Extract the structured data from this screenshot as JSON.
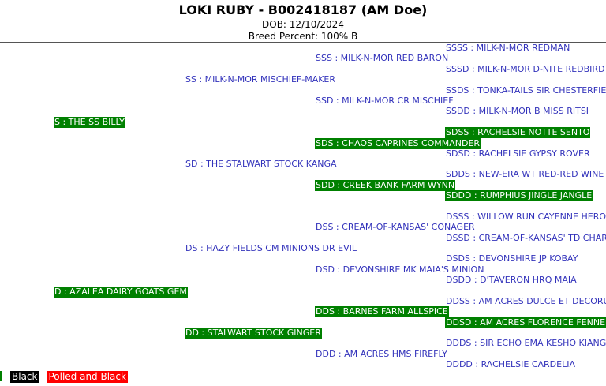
{
  "header": {
    "title": "LOKI RUBY - B002418187 (AM Doe)",
    "dob": "DOB: 12/10/2024",
    "breed_percent": "Breed Percent: 100% B"
  },
  "pedigree": {
    "S": "S : THE SS BILLY",
    "SS": "SS : MILK-N-MOR MISCHIEF-MAKER",
    "SSS": "SSS : MILK-N-MOR RED BARON",
    "SSSS": "SSSS : MILK-N-MOR REDMAN",
    "SSSD": "SSSD : MILK-N-MOR D-NITE REDBIRD",
    "SSD": "SSD : MILK-N-MOR CR MISCHIEF",
    "SSDS": "SSDS : TONKA-TAILS SIR CHESTERFIELD",
    "SSDD": "SSDD : MILK-N-MOR B MISS RITSI",
    "SD": "SD : THE STALWART STOCK KANGA",
    "SDS": "SDS : CHAOS CAPRINES COMMANDER",
    "SDSS": "SDSS : RACHELSIE NOTTE SENTO",
    "SDSD": "SDSD : RACHELSIE GYPSY ROVER",
    "SDD": "SDD : CREEK BANK FARM WYNN",
    "SDDS": "SDDS : NEW-ERA WT RED-RED WINE",
    "SDDD": "SDDD : RUMPHIUS JINGLE JANGLE",
    "D": "D : AZALEA DAIRY GOATS GEM",
    "DS": "DS : HAZY FIELDS CM MINIONS DR EVIL",
    "DSS": "DSS : CREAM-OF-KANSAS' CONAGER",
    "DSSS": "DSSS : WILLOW RUN CAYENNE HERO",
    "DSSD": "DSSD : CREAM-OF-KANSAS' TD CHARM",
    "DSD": "DSD : DEVONSHIRE MK MAIA'S MINION",
    "DSDS": "DSDS : DEVONSHIRE JP KOBAY",
    "DSDD": "DSDD : D'TAVERON HRQ MAIA",
    "DD": "DD : STALWART STOCK GINGER",
    "DDS": "DDS : BARNES FARM ALLSPICE",
    "DDSS": "DDSS : AM ACRES DULCE ET DECORUM",
    "DDSD": "DDSD : AM ACRES FLORENCE FENNEL",
    "DDD": "DDD : AM ACRES HMS FIREFLY",
    "DDDS": "DDDS : SIR ECHO EMA KESHO KIANGA",
    "DDDD": "DDDD : RACHELSIE CARDELIA"
  },
  "legend": {
    "black": "Black",
    "polled_black": "Polled and Black"
  },
  "colors": {
    "green_highlight": "#008000",
    "link_text": "#3333bb",
    "black_swatch": "#000000",
    "red_swatch": "#ff0000"
  }
}
